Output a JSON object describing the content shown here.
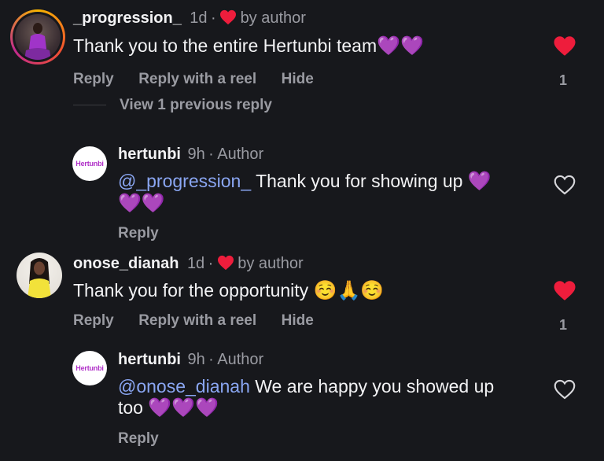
{
  "comments": [
    {
      "username": "_progression_",
      "time": "1d",
      "dot": "·",
      "liked_by": "by author",
      "text": "Thank you to the entire Hertunbi team",
      "emoji": "💜💜",
      "actions": [
        "Reply",
        "Reply with a reel",
        "Hide"
      ],
      "like_count": "1",
      "view_replies": "View 1 previous reply",
      "reply": {
        "username": "hertunbi",
        "time": "9h",
        "role": "· Author",
        "mention": "@_progression_",
        "text": " Thank you for showing up ",
        "emoji_line1": "💜",
        "emoji_line2": "💜💜",
        "action": "Reply",
        "logo_text": "Hertunbi"
      }
    },
    {
      "username": "onose_dianah",
      "time": "1d",
      "dot": "·",
      "liked_by": "by author",
      "text": "Thank you for the opportunity ",
      "emoji": "☺️🙏☺️",
      "actions": [
        "Reply",
        "Reply with a reel",
        "Hide"
      ],
      "like_count": "1",
      "reply": {
        "username": "hertunbi",
        "time": "9h",
        "role": "· Author",
        "mention": "@onose_dianah",
        "text": " We are happy you showed up",
        "text_line2": "too ",
        "emoji_line2": "💜💜💜",
        "action": "Reply",
        "logo_text": "Hertunbi"
      }
    }
  ],
  "icons": {
    "liked_heart": "heart-filled-icon",
    "unliked_heart": "heart-outline-icon"
  },
  "colors": {
    "background": "#17181c",
    "like_red": "#ee1d3c",
    "mention_blue": "#8aa6f2",
    "muted": "#9a9ba2"
  }
}
